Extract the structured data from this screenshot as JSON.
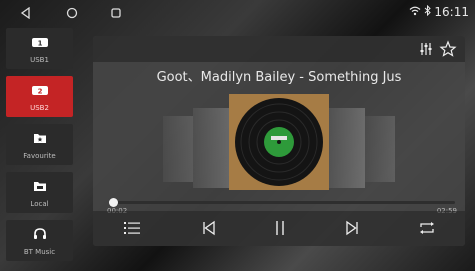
{
  "status": {
    "time": "16:11",
    "icons": [
      "wifi-icon",
      "bluetooth-icon"
    ]
  },
  "nav": {
    "icons": [
      "back-icon",
      "home-icon",
      "recents-icon"
    ]
  },
  "sidebar": {
    "items": [
      {
        "label": "USB1",
        "icon": "usb1-icon",
        "active": false
      },
      {
        "label": "USB2",
        "icon": "usb2-icon",
        "active": true
      },
      {
        "label": "Favourite",
        "icon": "favourite-folder-icon",
        "active": false
      },
      {
        "label": "Local",
        "icon": "local-folder-icon",
        "active": false
      },
      {
        "label": "BT Music",
        "icon": "headphones-icon",
        "active": false
      }
    ]
  },
  "player": {
    "track_title": "Goot、Madilyn Bailey - Something Jus",
    "time_elapsed": "00:02",
    "time_total": "02:59",
    "progress_fraction": 0.011,
    "header_icons": [
      "equalizer-icon",
      "star-icon"
    ],
    "controls": [
      "playlist-icon",
      "previous-icon",
      "pause-icon",
      "next-icon",
      "repeat-icon"
    ]
  },
  "colors": {
    "accent": "#c42425",
    "label_green": "#2e9a3a",
    "cover_brown": "#a67c45"
  }
}
